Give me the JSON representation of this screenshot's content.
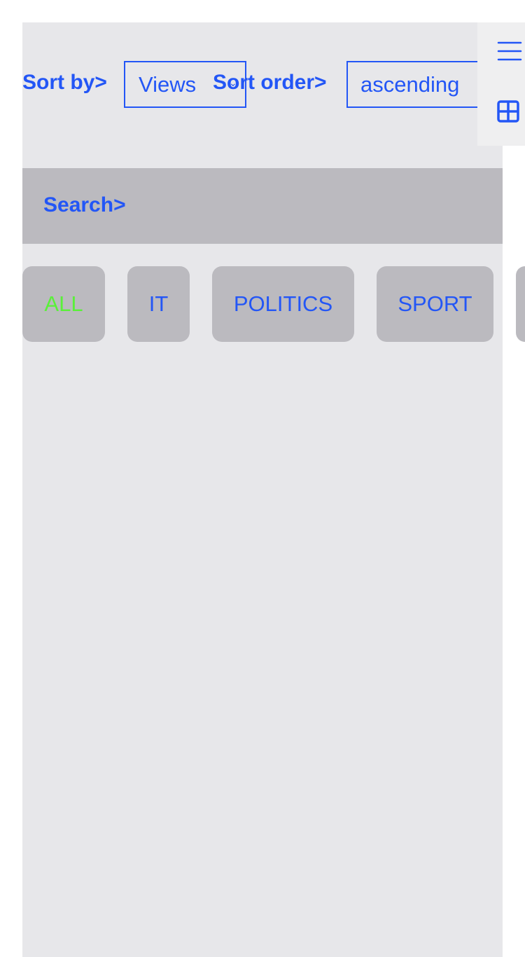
{
  "toolbar": {
    "sort_by_label": "Sort by>",
    "sort_by_value": "Views",
    "sort_order_label": "Sort order>",
    "sort_order_value": "ascending"
  },
  "search": {
    "label": "Search>"
  },
  "categories": [
    {
      "label": "ALL",
      "active": true
    },
    {
      "label": "IT"
    },
    {
      "label": "POLITICS"
    },
    {
      "label": "SPORT"
    }
  ],
  "colors": {
    "accent": "#2356f6",
    "active": "#5af03a"
  }
}
